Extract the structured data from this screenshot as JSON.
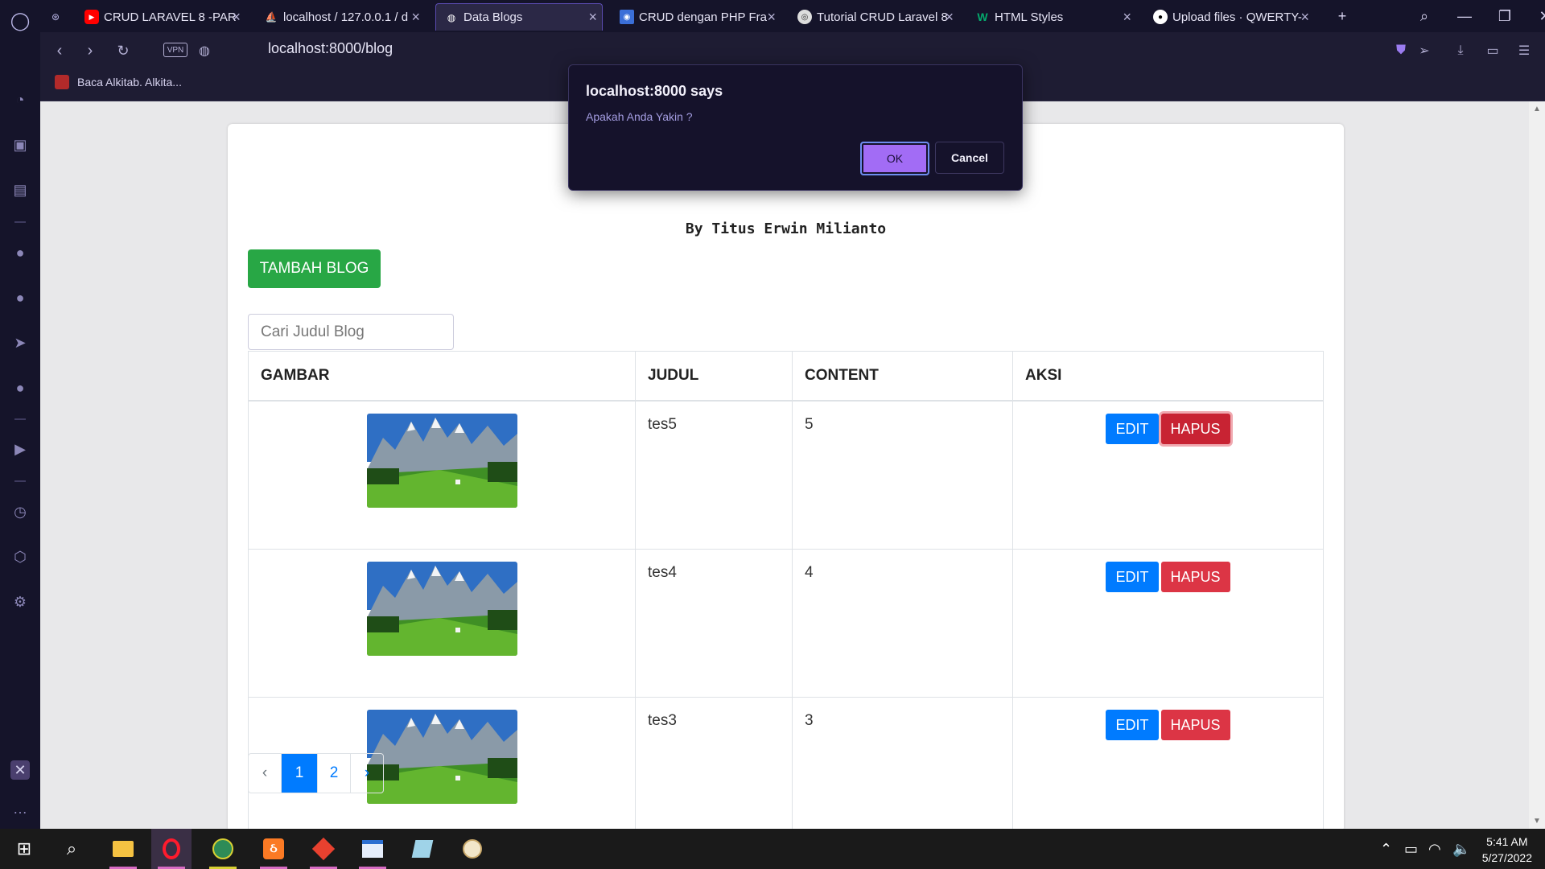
{
  "browser": {
    "tabs": [
      {
        "title": "CRUD LARAVEL 8 -PAR",
        "icon": "youtube-icon"
      },
      {
        "title": "localhost / 127.0.0.1 / d",
        "icon": "phpmyadmin-icon"
      },
      {
        "title": "Data Blogs",
        "icon": "globe-icon",
        "active": true
      },
      {
        "title": "CRUD dengan PHP Fra",
        "icon": "contact-icon"
      },
      {
        "title": "Tutorial CRUD Laravel 8",
        "icon": "site-icon"
      },
      {
        "title": "HTML Styles",
        "icon": "w3schools-icon"
      },
      {
        "title": "Upload files · QWERTY-",
        "icon": "github-icon"
      }
    ],
    "url": "localhost:8000/blog",
    "vpn_label": "VPN",
    "bookmark": "Baca Alkitab. Alkita..."
  },
  "page": {
    "byline": "By Titus Erwin Milianto",
    "add_button": "TAMBAH BLOG",
    "search_placeholder": "Cari Judul Blog",
    "table": {
      "headers": [
        "GAMBAR",
        "JUDUL",
        "CONTENT",
        "AKSI"
      ],
      "rows": [
        {
          "judul": "tes5",
          "content": "5"
        },
        {
          "judul": "tes4",
          "content": "4"
        },
        {
          "judul": "tes3",
          "content": "3"
        }
      ],
      "edit_label": "EDIT",
      "delete_label": "HAPUS"
    },
    "pagination": {
      "prev": "‹",
      "pages": [
        "1",
        "2"
      ],
      "active": "1",
      "next": "›"
    }
  },
  "dialog": {
    "title": "localhost:8000 says",
    "message": "Apakah Anda Yakin ?",
    "ok": "OK",
    "cancel": "Cancel"
  },
  "taskbar": {
    "time": "5:41 AM",
    "date": "5/27/2022"
  },
  "colors": {
    "accent": "#a26cf5",
    "success": "#28a745",
    "primary": "#007bff",
    "danger": "#dc3545"
  }
}
